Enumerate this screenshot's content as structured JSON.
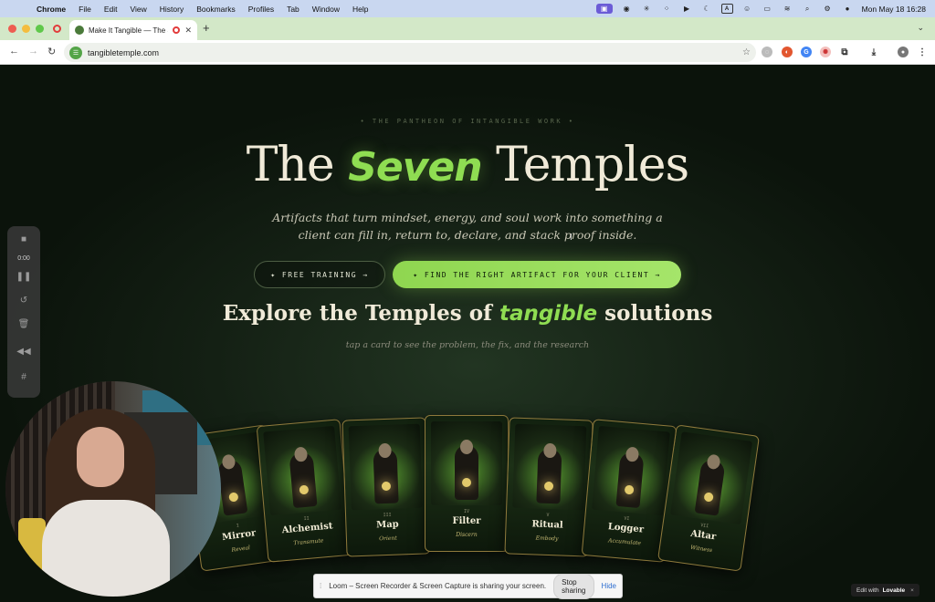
{
  "menubar": {
    "app": "Chrome",
    "items": [
      "File",
      "Edit",
      "View",
      "History",
      "Bookmarks",
      "Profiles",
      "Tab",
      "Window",
      "Help"
    ],
    "clock": "Mon May 18  16:28"
  },
  "browser": {
    "tab_title": "Make It Tangible — The Se",
    "url": "tangibletemple.com"
  },
  "hero": {
    "eyebrow": "•   THE PANTHEON OF INTANGIBLE WORK   •",
    "title_pre": "The ",
    "title_accent": "Seven",
    "title_post": " Temples",
    "subtitle": "Artifacts that turn mindset, energy, and soul work into something a client can fill in, return to, declare, and stack proof inside.",
    "btn_training": "✦ FREE TRAINING →",
    "btn_artifact": "✦ FIND THE RIGHT ARTIFACT FOR YOUR CLIENT →"
  },
  "section": {
    "title_pre": "Explore the Temples of ",
    "title_accent": "tangible",
    "title_post": " solutions",
    "hint": "tap a card to see the problem, the fix, and the research"
  },
  "cards": [
    {
      "num": "I",
      "name": "Mirror",
      "verb": "Reveal"
    },
    {
      "num": "II",
      "name": "Alchemist",
      "verb": "Transmute"
    },
    {
      "num": "III",
      "name": "Map",
      "verb": "Orient"
    },
    {
      "num": "IV",
      "name": "Filter",
      "verb": "Discern"
    },
    {
      "num": "V",
      "name": "Ritual",
      "verb": "Embody"
    },
    {
      "num": "VI",
      "name": "Logger",
      "verb": "Accumulate"
    },
    {
      "num": "VII",
      "name": "Altar",
      "verb": "Witness"
    }
  ],
  "loom": {
    "timer": "0:00",
    "share_msg": "Loom – Screen Recorder & Screen Capture is sharing your screen.",
    "stop_label": "Stop sharing",
    "hide_label": "Hide"
  },
  "badge": {
    "prefix": "Edit with",
    "brand": "Lovable",
    "close": "×"
  },
  "colors": {
    "accent": "#8fdd52",
    "background": "#0b120b",
    "card_border": "#8f7a3c"
  }
}
